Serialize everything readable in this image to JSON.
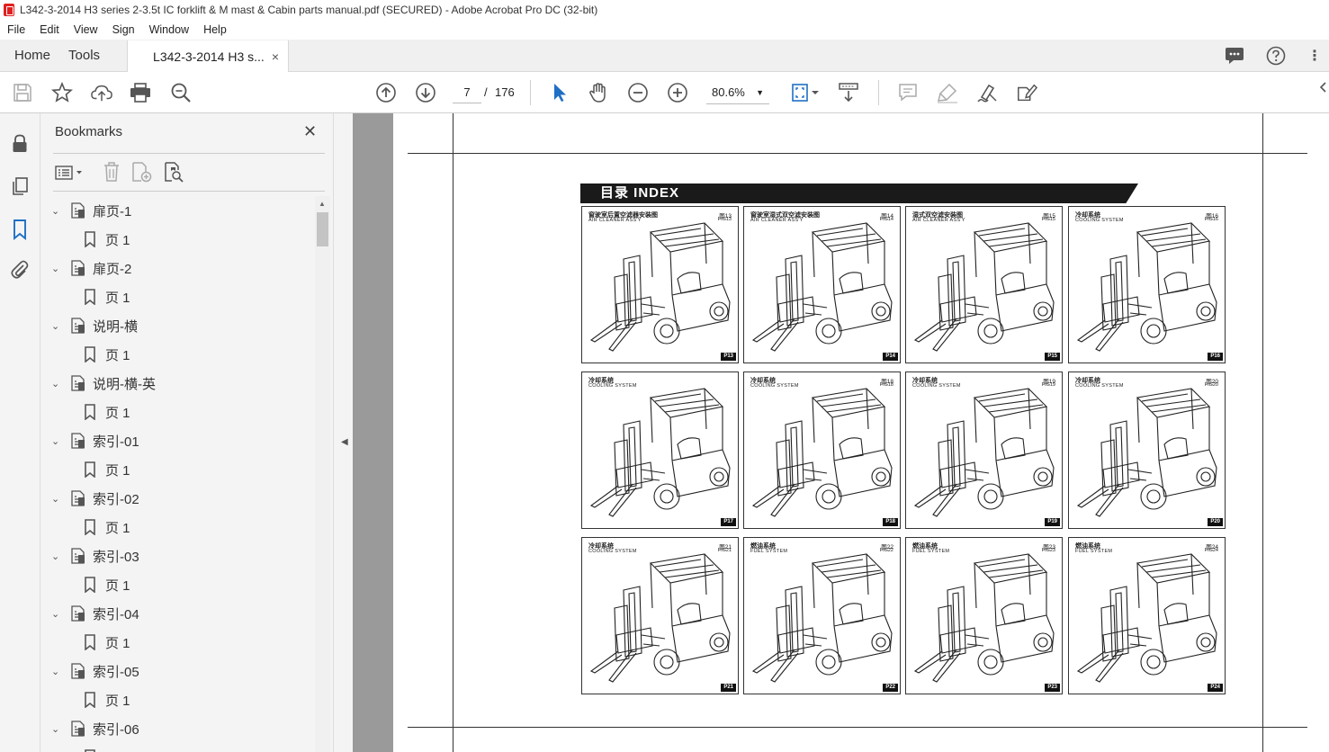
{
  "window": {
    "title": "L342-3-2014 H3 series 2-3.5t IC forklift & M mast & Cabin parts manual.pdf (SECURED) - Adobe Acrobat Pro DC (32-bit)"
  },
  "menu": [
    "File",
    "Edit",
    "View",
    "Sign",
    "Window",
    "Help"
  ],
  "tabs": {
    "home": "Home",
    "tools": "Tools",
    "document": "L342-3-2014 H3 s...",
    "close": "×"
  },
  "toolbar": {
    "current_page": "7",
    "page_sep": "/",
    "total_pages": "176",
    "zoom": "80.6%"
  },
  "bookmarks": {
    "title": "Bookmarks",
    "close": "✕",
    "items": [
      {
        "label": "扉页-1",
        "child": "页 1"
      },
      {
        "label": "扉页-2",
        "child": "页 1"
      },
      {
        "label": "说明-横",
        "child": "页 1"
      },
      {
        "label": "说明-横-英",
        "child": "页 1"
      },
      {
        "label": "索引-01",
        "child": "页 1"
      },
      {
        "label": "索引-02",
        "child": "页 1"
      },
      {
        "label": "索引-03",
        "child": "页 1"
      },
      {
        "label": "索引-04",
        "child": "页 1"
      },
      {
        "label": "索引-05",
        "child": "页 1"
      },
      {
        "label": "索引-06",
        "child": "页 1"
      }
    ]
  },
  "document": {
    "banner": "目录  INDEX",
    "figures": [
      {
        "cn": "窗驶室后置空滤器安装图",
        "en": "AIR CLEANER ASS'Y",
        "fig_cn": "图13",
        "fig_en": "FIG13",
        "page": "P13"
      },
      {
        "cn": "窗驶室湿式双空滤安装图",
        "en": "AIR CLEANER ASS'Y",
        "fig_cn": "图14",
        "fig_en": "FIG14",
        "page": "P14"
      },
      {
        "cn": "湿式双空滤安装图",
        "en": "AIR CLEANER ASS'Y",
        "fig_cn": "图15",
        "fig_en": "FIG15",
        "page": "P15"
      },
      {
        "cn": "冷却系统",
        "en": "COOLING SYSTEM",
        "fig_cn": "图16",
        "fig_en": "FIG16",
        "page": "P16"
      },
      {
        "cn": "冷却系统",
        "en": "COOLING SYSTEM",
        "fig_cn": "",
        "fig_en": "",
        "page": "P17"
      },
      {
        "cn": "冷却系统",
        "en": "COOLING SYSTEM",
        "fig_cn": "图18",
        "fig_en": "FIG18",
        "page": "P18"
      },
      {
        "cn": "冷却系统",
        "en": "COOLING SYSTEM",
        "fig_cn": "图19",
        "fig_en": "FIG19",
        "page": "P19"
      },
      {
        "cn": "冷却系统",
        "en": "COOLING SYSTEM",
        "fig_cn": "图20",
        "fig_en": "FIG20",
        "page": "P20"
      },
      {
        "cn": "冷却系统",
        "en": "COOLING SYSTEM",
        "fig_cn": "图21",
        "fig_en": "FIG21",
        "page": "P21"
      },
      {
        "cn": "燃油系统",
        "en": "FUEL SYSTEM",
        "fig_cn": "图22",
        "fig_en": "FIG22",
        "page": "P22"
      },
      {
        "cn": "燃油系统",
        "en": "FUEL SYSTEM",
        "fig_cn": "图23",
        "fig_en": "FIG23",
        "page": "P23"
      },
      {
        "cn": "燃油系统",
        "en": "FUEL SYSTEM",
        "fig_cn": "图24",
        "fig_en": "FIG24",
        "page": "P24"
      }
    ]
  },
  "colors": {
    "accent_blue": "#1f6fc5",
    "pdf_red": "#e02020",
    "doc_background": "#9a9a9a"
  }
}
